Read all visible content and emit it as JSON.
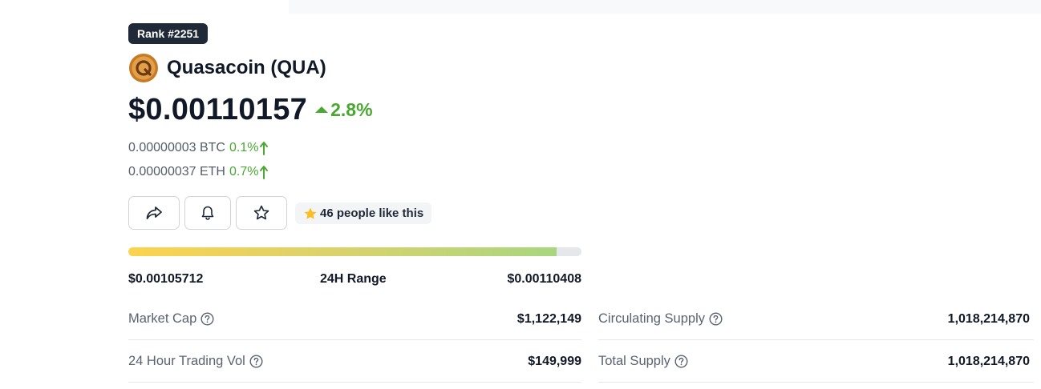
{
  "header": {
    "rank": "Rank #2251"
  },
  "coin": {
    "name": "Quasacoin (QUA)",
    "logo_icon": "quasacoin-logo-icon",
    "price": "$0.00110157",
    "change_24h": "2.8%",
    "change_direction": "up"
  },
  "conversions": [
    {
      "value": "0.00000003 BTC",
      "change": "0.1%",
      "direction": "up"
    },
    {
      "value": "0.00000037 ETH",
      "change": "0.7%",
      "direction": "up"
    }
  ],
  "actions": {
    "share_icon": "share-icon",
    "alert_icon": "bell-icon",
    "watchlist_icon": "star-icon",
    "likes_text": "46 people like this"
  },
  "range_24h": {
    "low": "$0.00105712",
    "label": "24H Range",
    "high": "$0.00110408",
    "position_fraction": 0.945
  },
  "stats": {
    "market_cap": {
      "label": "Market Cap",
      "value": "$1,122,149"
    },
    "trading_vol": {
      "label": "24 Hour Trading Vol",
      "value": "$149,999"
    },
    "circulating_supply": {
      "label": "Circulating Supply",
      "value": "1,018,214,870"
    },
    "total_supply": {
      "label": "Total Supply",
      "value": "1,018,214,870"
    }
  },
  "colors": {
    "positive": "#4aa832",
    "badge_bg": "#1f2937",
    "range_start": "#fcd34d",
    "range_end": "#a8d67f"
  }
}
